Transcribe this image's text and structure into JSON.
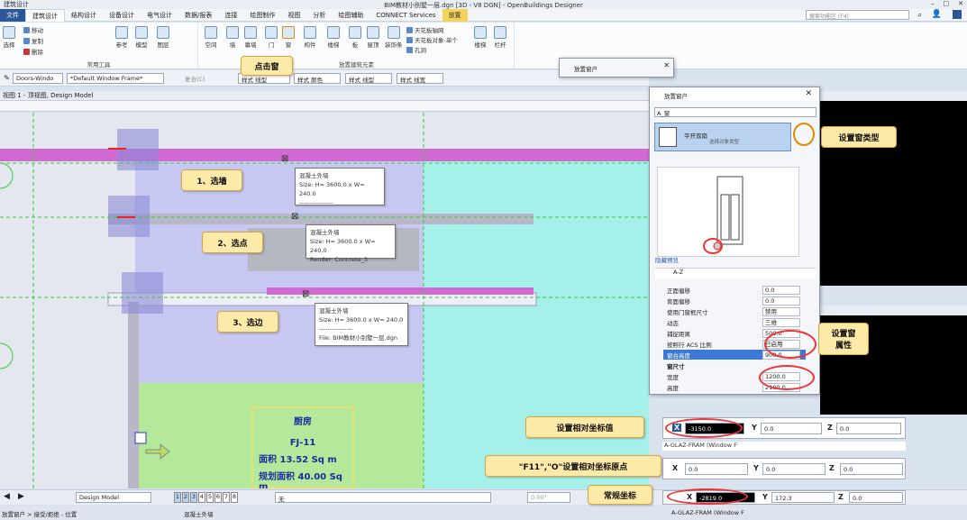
{
  "titlebar": {
    "workflow": "建筑设计",
    "title": "BIM教材小别墅一层.dgn [3D - V8 DGN] - OpenBuildings Designer"
  },
  "menu": {
    "file": "文件",
    "tabs": [
      "建筑设计",
      "结构设计",
      "设备设计",
      "电气设计",
      "数据/报表",
      "连接",
      "绘图制作",
      "视图",
      "分析",
      "绘图辅助",
      "CONNECT Services",
      "放置"
    ],
    "search_placeholder": "搜索功能区 (F4)"
  },
  "ribbon": {
    "select": "选择",
    "move": "移动",
    "copy": "复制",
    "delete": "删除",
    "common_group": "常用工具",
    "attach": "参考",
    "model": "模型",
    "layer": "图层",
    "space": "空间",
    "wall": "墙",
    "curtain": "幕墙",
    "door": "门",
    "window": "窗",
    "member": "构件",
    "stair": "楼梯",
    "slab": "板",
    "roof": "屋顶",
    "finish": "装饰条",
    "ceiling_grid": "天花板轴网",
    "ceiling_single": "天花板对象-单个",
    "hole": "孔洞",
    "rail": "楼梯",
    "railing": "栏杆",
    "building_group": "放置建筑元素"
  },
  "toolbar2": {
    "catalog": "Doors-Windo",
    "style": "*Default Window Frame*",
    "composite": "复合(C)",
    "line_style": "样式 线型",
    "color": "样式 颜色",
    "style_line": "样式 线型",
    "style_weight": "样式 线宽"
  },
  "view": {
    "title": "视图 1 - 顶视图, Design Model"
  },
  "room": {
    "name": "厨房",
    "code": "FJ-11",
    "area": "面积 13.52 Sq m",
    "planned": "规划面积 40.00 Sq m"
  },
  "tooltips": [
    {
      "l1": "混凝土外墙",
      "l2": "Size: H= 3600.0 x W= 240.0",
      "l3": "----------------"
    },
    {
      "l1": "混凝土外墙",
      "l2": "Size: H= 3600.0 x W= 240.0",
      "l3": "Render: Concrete_3"
    },
    {
      "l1": "混凝土外墙",
      "l2": "Size: H= 3600.0 x W= 240.0",
      "l3": "----------------",
      "l4": "File: BIM教材小别墅一层.dgn"
    }
  ],
  "mini_dialog": {
    "title": "放置窗户"
  },
  "dialog": {
    "title": "放置窗户",
    "type_label": "A_窗",
    "catalog_item": "平开双扇",
    "catalog_sub": "选择对象类型",
    "hidden_link": "隐藏预览",
    "tabs": [
      "A-Z"
    ],
    "props": [
      {
        "name": "正面偏移",
        "value": "0.0"
      },
      {
        "name": "背面偏移",
        "value": "0.0"
      },
      {
        "name": "使用门窗框尺寸",
        "value": "禁用"
      },
      {
        "name": "动态",
        "value": "三维"
      },
      {
        "name": "捕捉距离",
        "value": "500.0"
      },
      {
        "name": "按照行 ACS 比例",
        "value": "已启用"
      },
      {
        "name": "窗台高度",
        "value": "900.0"
      }
    ],
    "section": "窗尺寸",
    "size_props": [
      {
        "name": "宽度",
        "value": "1200.0"
      },
      {
        "name": "高度",
        "value": "2100.0"
      }
    ]
  },
  "coords": {
    "relative": {
      "x": "-3150.0",
      "y": "0.0",
      "z": "0.0"
    },
    "origin": {
      "x": "0.0",
      "y": "0.0",
      "z": "0.0"
    },
    "normal": {
      "x": "-2819.0",
      "y": "172.3",
      "z": "0.0"
    },
    "panel_label": "A-GLAZ-FRAM (Window F"
  },
  "callouts": {
    "click_window": "点击窗",
    "select_wall": "1、选墙",
    "select_point": "2、选点",
    "select_edge": "3、选边",
    "set_type": "设置窗类型",
    "set_props_1": "设置窗",
    "set_props_2": "属性",
    "set_rel": "设置相对坐标值",
    "set_origin": "\"F11\",\"O\"设置相对坐标原点",
    "normal_coord": "常规坐标"
  },
  "bottom": {
    "model": "Design Model",
    "views": [
      "1",
      "2",
      "3",
      "4",
      "5",
      "6",
      "7",
      "8"
    ],
    "level": "无",
    "angle": "0.00°"
  },
  "status": {
    "left": "放置窗户 > 接受/拒绝 - 位置",
    "mid": "混凝土外墙",
    "right": "A-GLAZ-FRAM (Window F"
  }
}
